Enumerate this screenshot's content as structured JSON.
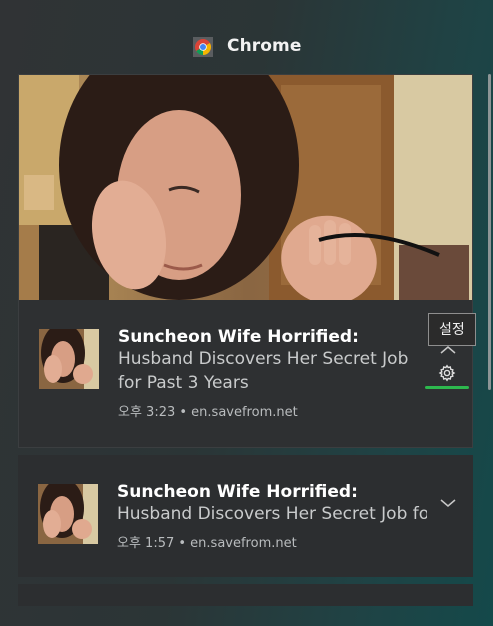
{
  "app": {
    "title": "Chrome",
    "icon": "chrome-icon"
  },
  "tooltip": {
    "label": "설정"
  },
  "notifications": [
    {
      "title": "Suncheon Wife Horrified:",
      "body_line1": "Husband Discovers Her Secret Job",
      "body_line2": "for Past 3 Years",
      "time": "오후 3:23",
      "source": "en.savefrom.net",
      "meta": "오후 3:23 • en.savefrom.net",
      "has_hero_image": true,
      "actions": [
        "chevron-up-icon",
        "gear-icon"
      ]
    },
    {
      "title": "Suncheon Wife Horrified:",
      "body_line1": "Husband Discovers Her Secret Job fo",
      "time": "오후 1:57",
      "source": "en.savefrom.net",
      "meta": "오후 1:57 • en.savefrom.net",
      "has_hero_image": false,
      "actions": [
        "chevron-down-icon"
      ]
    }
  ],
  "colors": {
    "accent_focus": "#2db84e",
    "card_bg": "#2c2e30",
    "title_text": "#ffffff",
    "body_text": "#c9cbcc"
  }
}
